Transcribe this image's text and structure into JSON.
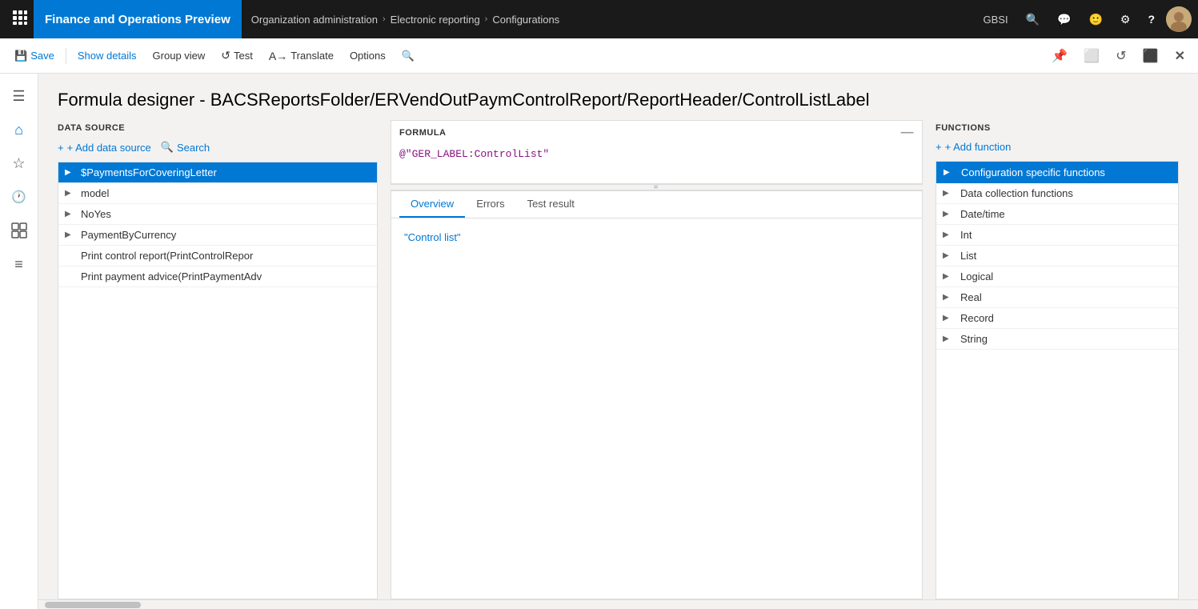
{
  "topbar": {
    "app_title": "Finance and Operations Preview",
    "breadcrumbs": [
      {
        "label": "Organization administration"
      },
      {
        "label": "Electronic reporting"
      },
      {
        "label": "Configurations"
      }
    ],
    "org_label": "GBSI",
    "icons": {
      "search": "🔍",
      "chat": "💬",
      "emoji": "🙂",
      "settings": "⚙",
      "help": "?",
      "apps": "⠿"
    }
  },
  "actionbar": {
    "buttons": [
      {
        "label": "Save",
        "icon": "💾",
        "name": "save-button"
      },
      {
        "label": "Show details",
        "name": "show-details-button"
      },
      {
        "label": "Group view",
        "name": "group-view-button"
      },
      {
        "label": "Test",
        "name": "test-button"
      },
      {
        "label": "Translate",
        "name": "translate-button"
      },
      {
        "label": "Options",
        "name": "options-button"
      }
    ],
    "right_icons": [
      "📌",
      "⬜",
      "↺",
      "⬜",
      "✕"
    ]
  },
  "page": {
    "title": "Formula designer - BACSReportsFolder/ERVendOutPaymControlReport/ReportHeader/ControlListLabel"
  },
  "datasource": {
    "header": "DATA SOURCE",
    "add_label": "+ Add data source",
    "search_label": "Search",
    "items": [
      {
        "label": "$PaymentsForCoveringLetter",
        "indent": 0,
        "has_children": true,
        "selected": true
      },
      {
        "label": "model",
        "indent": 0,
        "has_children": true,
        "selected": false
      },
      {
        "label": "NoYes",
        "indent": 0,
        "has_children": true,
        "selected": false
      },
      {
        "label": "PaymentByCurrency",
        "indent": 0,
        "has_children": true,
        "selected": false
      },
      {
        "label": "Print control report(PrintControlRepor",
        "indent": 0,
        "has_children": false,
        "selected": false
      },
      {
        "label": "Print payment advice(PrintPaymentAdv",
        "indent": 0,
        "has_children": false,
        "selected": false
      }
    ]
  },
  "formula": {
    "label": "FORMULA",
    "value": "@\"GER_LABEL:ControlList\"",
    "collapse_icon": "—"
  },
  "bottom_tabs": {
    "tabs": [
      {
        "label": "Overview",
        "active": true
      },
      {
        "label": "Errors",
        "active": false
      },
      {
        "label": "Test result",
        "active": false
      }
    ],
    "overview_result": "\"Control list\""
  },
  "functions": {
    "header": "FUNCTIONS",
    "add_label": "+ Add function",
    "items": [
      {
        "label": "Configuration specific functions",
        "has_children": true,
        "selected": true
      },
      {
        "label": "Data collection functions",
        "has_children": true,
        "selected": false
      },
      {
        "label": "Date/time",
        "has_children": true,
        "selected": false
      },
      {
        "label": "Int",
        "has_children": true,
        "selected": false
      },
      {
        "label": "List",
        "has_children": true,
        "selected": false
      },
      {
        "label": "Logical",
        "has_children": true,
        "selected": false
      },
      {
        "label": "Real",
        "has_children": true,
        "selected": false
      },
      {
        "label": "Record",
        "has_children": true,
        "selected": false
      },
      {
        "label": "String",
        "has_children": true,
        "selected": false
      }
    ]
  },
  "sidebar": {
    "icons": [
      {
        "name": "hamburger-menu",
        "symbol": "☰"
      },
      {
        "name": "home-icon",
        "symbol": "⌂"
      },
      {
        "name": "favorites-icon",
        "symbol": "★"
      },
      {
        "name": "recent-icon",
        "symbol": "🕐"
      },
      {
        "name": "workspaces-icon",
        "symbol": "⊞"
      },
      {
        "name": "modules-icon",
        "symbol": "≡"
      }
    ]
  }
}
